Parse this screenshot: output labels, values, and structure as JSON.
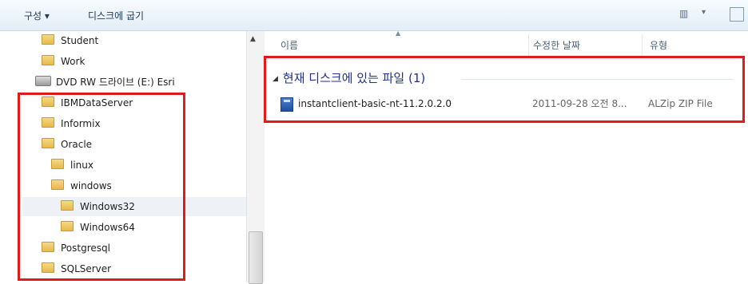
{
  "toolbar": {
    "organize_label": "구성 ▾",
    "burn_label": "디스크에 굽기",
    "view_icon": "view-options-icon",
    "view_arrow": "▾",
    "preview_icon": "preview-pane-icon"
  },
  "nav": {
    "items": [
      {
        "label": "Student"
      },
      {
        "label": "Work"
      },
      {
        "label": "DVD RW 드라이브 (E:) Esri"
      },
      {
        "label": "IBMDataServer"
      },
      {
        "label": "Informix"
      },
      {
        "label": "Oracle"
      },
      {
        "label": "linux"
      },
      {
        "label": "windows"
      },
      {
        "label": "Windows32"
      },
      {
        "label": "Windows64"
      },
      {
        "label": "Postgresql"
      },
      {
        "label": "SQLServer"
      }
    ]
  },
  "columns": {
    "name": "이름",
    "date": "수정한 날짜",
    "type": "유형"
  },
  "group": {
    "title": "현재 디스크에 있는 파일 (1)"
  },
  "files": [
    {
      "name": "instantclient-basic-nt-11.2.0.2.0",
      "date": "2011-09-28 오전 8...",
      "type": "ALZip ZIP File"
    }
  ],
  "colors": {
    "highlight": "#e31a1a",
    "group_title": "#1e3287"
  }
}
